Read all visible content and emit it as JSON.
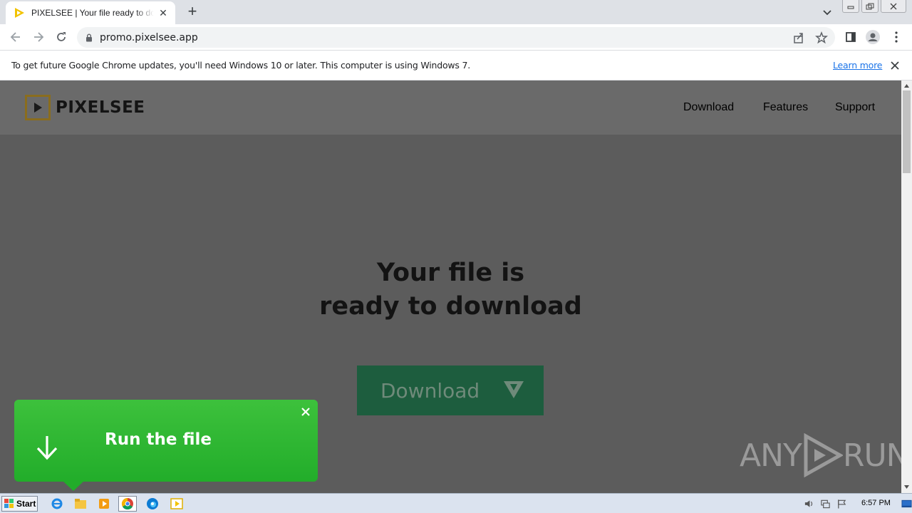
{
  "browser": {
    "tab_title": "PIXELSEE | Your file ready to download",
    "url": "promo.pixelsee.app"
  },
  "infobar": {
    "message": "To get future Google Chrome updates, you'll need Windows 10 or later. This computer is using Windows 7.",
    "link_label": "Learn more"
  },
  "site": {
    "logo_text": "PIXELSEE",
    "nav": {
      "download": "Download",
      "features": "Features",
      "support": "Support"
    },
    "hero_line1": "Your file is",
    "hero_line2": "ready to download",
    "download_button": "Download"
  },
  "popup": {
    "label": "Run the file"
  },
  "watermark": {
    "text_left": "ANY",
    "text_right": "RUN"
  },
  "taskbar": {
    "start_label": "Start",
    "clock": "6:57 PM"
  },
  "colors": {
    "popup_green": "#2bb52f",
    "download_green": "#1d5d3e",
    "logo_gold": "#8a6d1e",
    "link_blue": "#1a73e8"
  }
}
